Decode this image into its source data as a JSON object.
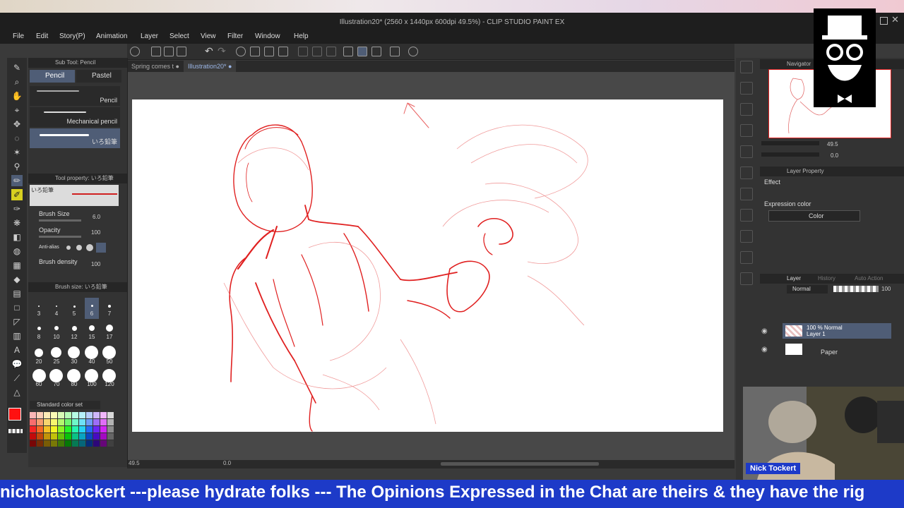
{
  "window": {
    "title": "Illustration20* (2560 x 1440px 600dpi 49.5%) - CLIP STUDIO PAINT EX"
  },
  "menu": [
    "File",
    "Edit",
    "Story(P)",
    "Animation",
    "Layer",
    "Select",
    "View",
    "Filter",
    "Window",
    "Help"
  ],
  "tabs": [
    {
      "label": "Spring comes t"
    },
    {
      "label": "Illustration20*"
    }
  ],
  "subtool": {
    "header": "Sub Tool: Pencil",
    "tabs": [
      "Pencil",
      "Pastel"
    ],
    "brushes": [
      "Pencil",
      "Mechanical pencil",
      "いろ鉛筆"
    ]
  },
  "tool_property": {
    "header": "Tool property: いろ鉛筆",
    "brush_name": "いろ鉛筆",
    "brush_size_label": "Brush Size",
    "brush_size_value": "6.0",
    "opacity_label": "Opacity",
    "opacity_value": "100",
    "antialias_label": "Anti-alias",
    "density_label": "Brush density",
    "density_value": "100"
  },
  "brush_size_panel": {
    "header": "Brush size: いろ鉛筆",
    "sizes": [
      "3",
      "4",
      "5",
      "6",
      "7",
      "8",
      "10",
      "12",
      "15",
      "17",
      "20",
      "25",
      "30",
      "40",
      "50",
      "60",
      "70",
      "80",
      "100",
      "120"
    ]
  },
  "color_set": {
    "label": "Standard color set"
  },
  "navigator": {
    "header": "Navigator",
    "zoom": "49.5",
    "rotation": "0.0"
  },
  "layer_property": {
    "header": "Layer Property",
    "effect_label": "Effect",
    "expression_label": "Expression color",
    "expression_value": "Color"
  },
  "layer_panel": {
    "tabs": [
      "Layer",
      "History",
      "Auto Action"
    ],
    "blend": "Normal",
    "opacity": "100",
    "layers": [
      {
        "line1": "100 % Normal",
        "line2": "Layer 1"
      },
      {
        "line1": "Paper",
        "line2": ""
      }
    ]
  },
  "statusbar": {
    "zoom": "49.5",
    "angle": "0.0"
  },
  "stream": {
    "ticker": "nicholastockert ---please hydrate folks --- The Opinions Expressed in the Chat are theirs & they have the rig",
    "cam_name": "Nick Tockert"
  },
  "colors": {
    "accent": "#1d3ac8",
    "sketch": "#e02020",
    "selected": "#4f5d76"
  }
}
